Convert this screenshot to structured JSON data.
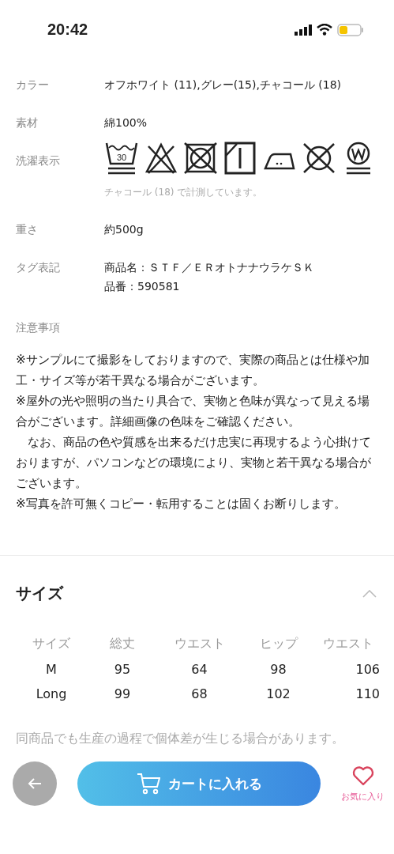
{
  "status_bar": {
    "time": "20:42"
  },
  "specs": [
    {
      "label": "カラー",
      "lines": [
        "オフホワイト (11),グレー(15),チャコール (18)"
      ]
    },
    {
      "label": "素材",
      "lines": [
        "綿100%"
      ]
    },
    {
      "label": "洗濯表示",
      "kind": "care",
      "wash_temperature": "30",
      "caption": "チャコール (18) で計測しています。"
    },
    {
      "label": "重さ",
      "lines": [
        "約500g"
      ]
    },
    {
      "label": "タグ表記",
      "lines": [
        "商品名：ＳＴＦ／ＥＲオトナナウラケＳＫ",
        "品番：590581"
      ]
    }
  ],
  "notes": {
    "title": "注意事項",
    "paragraphs": [
      "※サンプルにて撮影をしておりますので、実際の商品とは仕様や加工・サイズ等が若干異なる場合がございます。",
      "※屋外の光や照明の当たり具合で、実物と色味が異なって見える場合がございます。詳細画像の色味をご確認ください。",
      "　なお、商品の色や質感を出来るだけ忠実に再現するよう心掛けておりますが、パソコンなどの環境により、実物と若干異なる場合がございます。",
      "※写真を許可無くコピー・転用することは固くお断りします。"
    ]
  },
  "size_section": {
    "title": "サイズ",
    "expanded": true,
    "columns": [
      "サイズ",
      "総丈",
      "ウエスト",
      "ヒップ",
      "ウエスト"
    ],
    "rows": [
      [
        "M",
        "95",
        "64",
        "98",
        "106"
      ],
      [
        "Long",
        "99",
        "68",
        "102",
        "110"
      ]
    ],
    "footnote": "同商品でも生産の過程で個体差が生じる場合があります。"
  },
  "bottom_bar": {
    "cart_button": "カートに入れる",
    "favorite_label": "お気に入り"
  }
}
